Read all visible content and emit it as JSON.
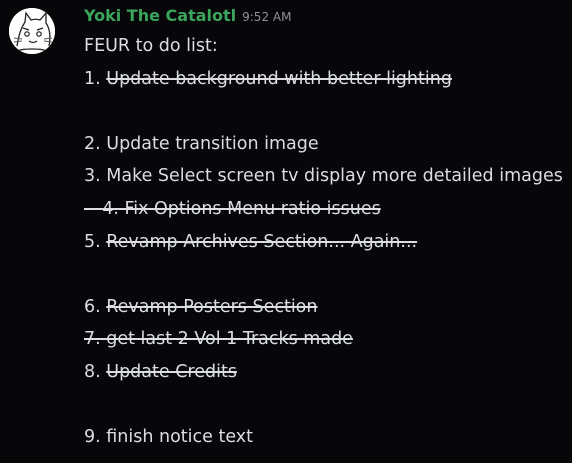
{
  "message": {
    "author": "Yoki The Catalotl",
    "timestamp": "9:52 AM",
    "author_color": "#3ba55d",
    "lines": [
      {
        "prefix": "FEUR to do list:",
        "text": ""
      },
      {
        "prefix": "1. ",
        "text": "Update background with better lighting"
      },
      {
        "prefix": "",
        "text": ""
      },
      {
        "prefix": "2. Update transition image",
        "text": ""
      },
      {
        "prefix": "3. Make Select screen tv display more detailed images",
        "text": ""
      },
      {
        "prefix": "",
        "text": "-- 4. Fix Options Menu ratio issues"
      },
      {
        "prefix": "5. ",
        "text": "Revamp Archives Section... Again..."
      },
      {
        "prefix": "",
        "text": ""
      },
      {
        "prefix": "6. ",
        "text": "Revamp Posters Section"
      },
      {
        "prefix": "",
        "text": "7. get last 2 Vol 1 Tracks made"
      },
      {
        "prefix": "8. ",
        "text": "Update Credits"
      },
      {
        "prefix": "",
        "text": ""
      },
      {
        "prefix": "9. finish notice text",
        "text": ""
      }
    ]
  },
  "colors": {
    "background": "#070709",
    "text": "#dbdee1",
    "timestamp": "#8e9297"
  },
  "icons": {
    "avatar": "cat-sketch-avatar-icon"
  }
}
